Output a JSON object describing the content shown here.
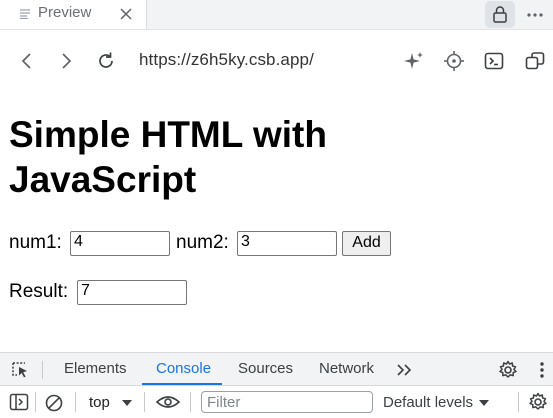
{
  "browser": {
    "tab": {
      "label": "Preview",
      "icon": "document-lines-icon"
    },
    "nav": {
      "url": "https://z6h5ky.csb.app/"
    }
  },
  "page": {
    "title": "Simple HTML with JavaScript",
    "num1_label": "num1:",
    "num1_value": "4",
    "num2_label": "num2:",
    "num2_value": "3",
    "add_label": "Add",
    "result_label": "Result:",
    "result_value": "7"
  },
  "devtools": {
    "tabs": [
      {
        "label": "Elements"
      },
      {
        "label": "Console"
      },
      {
        "label": "Sources"
      },
      {
        "label": "Network"
      }
    ],
    "active_tab": "Console",
    "context": "top",
    "filter_placeholder": "Filter",
    "levels": "Default levels"
  },
  "colors": {
    "accent": "#1a73e8",
    "toolbar_bg": "#f1f3f4"
  }
}
